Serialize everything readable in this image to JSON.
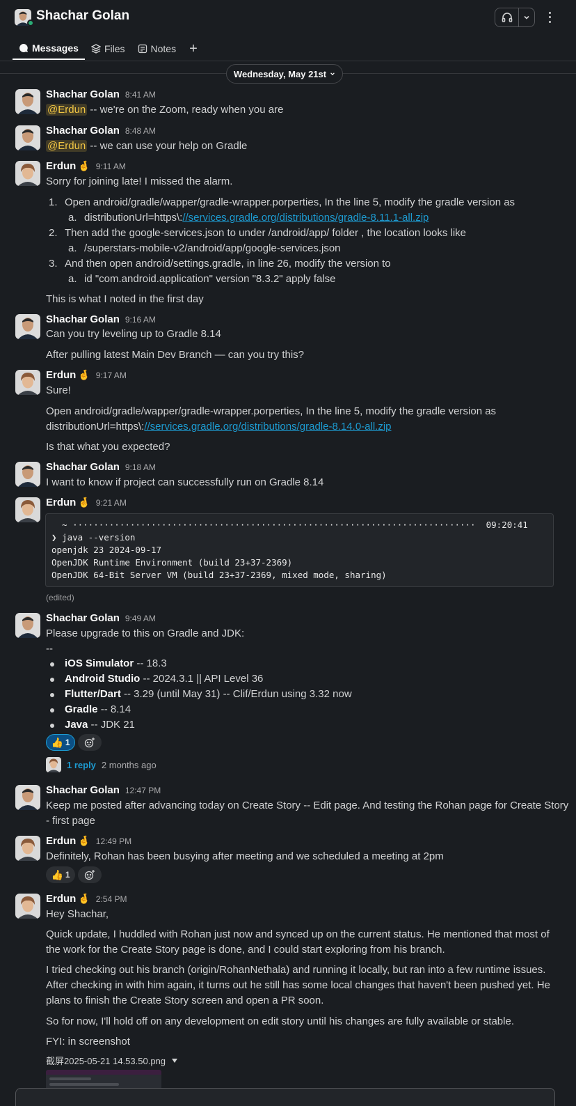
{
  "header": {
    "title": "Shachar Golan",
    "tabs": [
      {
        "label": "Messages",
        "active": true,
        "icon": "message-bubble-icon"
      },
      {
        "label": "Files",
        "icon": "layers-icon"
      },
      {
        "label": "Notes",
        "icon": "notes-icon"
      }
    ],
    "add_tab_label": "+"
  },
  "date_divider": "Wednesday, May 21st",
  "messages": [
    {
      "author": "Shachar Golan",
      "time": "8:41 AM",
      "mention": "@Erdun",
      "text": " -- we're on the Zoom, ready when you are"
    },
    {
      "author": "Shachar Golan",
      "time": "8:48 AM",
      "mention": "@Erdun",
      "text": " -- we can use your help on Gradle"
    },
    {
      "author": "Erdun",
      "status_emoji": "🤞",
      "time": "9:11 AM",
      "intro": "Sorry for joining late! I missed the alarm.",
      "steps": [
        {
          "n": "1.",
          "text": "Open android/gradle/wapper/gradle-wrapper.porperties, In the line 5, modify the gradle version as",
          "sub_n": "a.",
          "sub_prefix": "distributionUrl=https\\:",
          "sub_link": "//services.gradle.org/distributions/gradle-8.11.1-all.zip"
        },
        {
          "n": "2.",
          "text": "Then add the google-services.json to under /android/app/ folder , the location looks like",
          "sub_n": "a.",
          "sub_prefix": "/superstars-mobile-v2/android/app/google-services.json",
          "sub_link": ""
        },
        {
          "n": "3.",
          "text": "And then open android/settings.gradle, in line 26, modify the version to",
          "sub_n": "a.",
          "sub_prefix": "id \"com.android.application\" version \"8.3.2\" apply false",
          "sub_link": ""
        }
      ],
      "outro": "This is what I noted in the first day"
    },
    {
      "author": "Shachar Golan",
      "time": "9:16 AM",
      "line1": "Can you try leveling up to Gradle 8.14",
      "line2": "After pulling latest Main Dev Branch — can you try this?"
    },
    {
      "author": "Erdun",
      "status_emoji": "🤞",
      "time": "9:17 AM",
      "line1": "Sure!",
      "line2": "Open android/gradle/wapper/gradle-wrapper.porperties, In the line 5, modify the gradle version as",
      "line3_prefix": "distributionUrl=https\\:",
      "line3_link": "//services.gradle.org/distributions/gradle-8.14.0-all.zip",
      "line4": "Is that what you expected?"
    },
    {
      "author": "Shachar Golan",
      "time": "9:18 AM",
      "line1": "I want to know if project can successfully run on Gradle 8.14"
    },
    {
      "author": "Erdun",
      "status_emoji": "🤞",
      "time": "9:21 AM",
      "code": [
        "  ~ ·············································································  09:20:41",
        "❯ java --version",
        "openjdk 23 2024-09-17",
        "OpenJDK Runtime Environment (build 23+37-2369)",
        "OpenJDK 64-Bit Server VM (build 23+37-2369, mixed mode, sharing)"
      ],
      "edited": "(edited)"
    },
    {
      "author": "Shachar Golan",
      "time": "9:49 AM",
      "line1": "Please upgrade to this on Gradle and JDK:",
      "line2": "--",
      "bullets": [
        {
          "bold": "iOS Simulator",
          "rest": " -- 18.3"
        },
        {
          "bold": "Android Studio",
          "rest": " -- 2024.3.1 || API Level 36"
        },
        {
          "bold": "Flutter/Dart",
          "rest": " -- 3.29 (until May 31) -- Clif/Erdun using 3.32 now"
        },
        {
          "bold": "Gradle",
          "rest": " -- 8.14"
        },
        {
          "bold": "Java",
          "rest": " -- JDK 21"
        }
      ],
      "reaction_emoji": "👍",
      "reaction_count": "1",
      "thread_replies": "1 reply",
      "thread_time": "2 months ago"
    },
    {
      "author": "Shachar Golan",
      "time": "12:47 PM",
      "line1": "Keep me posted after advancing today on Create Story -- Edit page. And testing the Rohan page for Create Story",
      "line2": "- first page"
    },
    {
      "author": "Erdun",
      "status_emoji": "🤞",
      "time": "12:49 PM",
      "line1": "Definitely, Rohan has been busying after meeting and we scheduled a meeting at 2pm",
      "reaction_emoji": "👍",
      "reaction_count": "1"
    },
    {
      "author": "Erdun",
      "status_emoji": "🤞",
      "time": "2:54 PM",
      "p1": "Hey Shachar,",
      "p2a": "Quick update, I huddled with Rohan just now and synced up on the current status. He mentioned that most of",
      "p2b": "the work for the Create Story page is done, and I could start exploring from his branch.",
      "p3a": "I tried checking out his branch (origin/RohanNethala) and running it locally, but ran into a few runtime issues.",
      "p3b": "After checking in with him again, it turns out he still has some local changes that haven't been pushed yet. He",
      "p3c": "plans to finish the Create Story screen and open a PR soon.",
      "p4": "So for now, I'll hold off on any development on edit story until his changes are fully available or stable.",
      "p5": "FYI: in screenshot",
      "file_name": "截屏2025-05-21 14.53.50.png"
    }
  ],
  "colors": {
    "background": "#1a1d21",
    "link": "#1d9bd1",
    "mention": "#f2c744",
    "presence": "#2bac76"
  }
}
